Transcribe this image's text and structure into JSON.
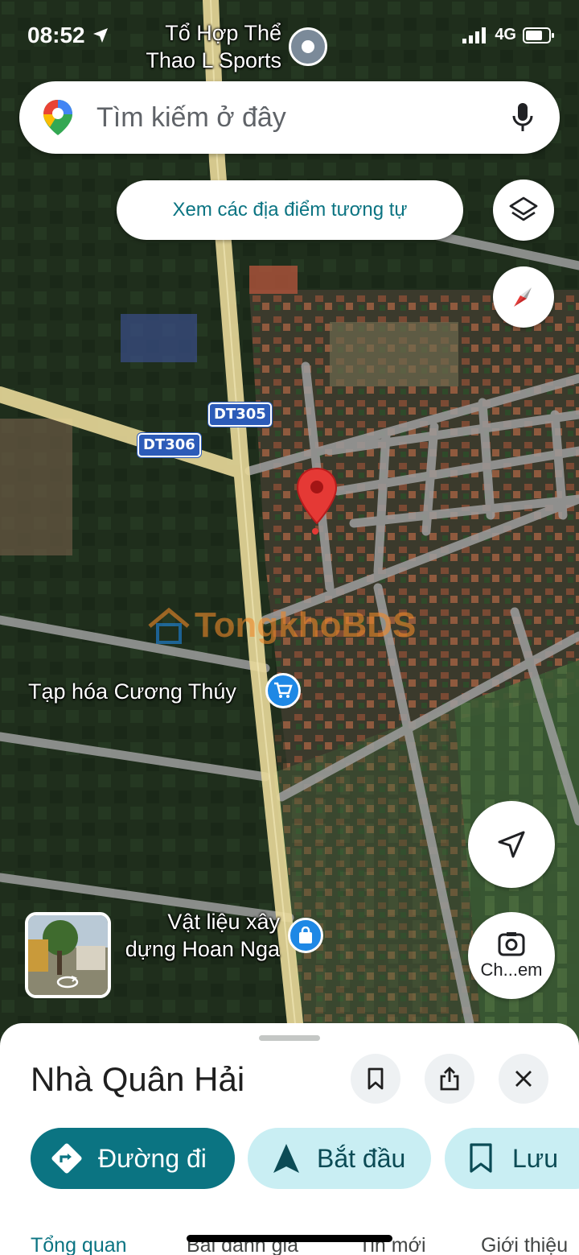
{
  "status_bar": {
    "time": "08:52",
    "network": "4G"
  },
  "search": {
    "placeholder": "Tìm kiếm ở đây"
  },
  "map": {
    "similar_places_label": "Xem các địa điểm tương tự",
    "road_shields": [
      "DT305",
      "DT306"
    ],
    "poi_labels": {
      "sports": "Tổ Hợp Thể\nThao L Sports",
      "grocery": "Tạp hóa Cương Thúy",
      "building": "Vật liệu xây\ndựng Hoan Nga"
    },
    "watermark": "TongkhoBDS",
    "lens_label": "Ch...em"
  },
  "place": {
    "name": "Nhà Quân Hải",
    "actions": {
      "directions": "Đường đi",
      "start": "Bắt đầu",
      "save": "Lưu"
    },
    "tabs": [
      "Tổng quan",
      "Bài đánh giá",
      "Tin mới",
      "Giới thiệu"
    ]
  },
  "colors": {
    "accent": "#0b7482",
    "chip_bg": "#c9eef3",
    "pin": "#e53935",
    "poi_blue": "#1e88e5",
    "shield": "#2c5bb8"
  },
  "icons": {
    "layers": "layers-icon",
    "compass": "compass-icon",
    "location": "my-location-icon",
    "lens": "google-lens-icon",
    "bookmark": "bookmark-icon",
    "share": "share-icon",
    "close": "close-icon",
    "mic": "mic-icon",
    "navigation": "navigation-arrow-icon",
    "directions": "directions-icon"
  }
}
